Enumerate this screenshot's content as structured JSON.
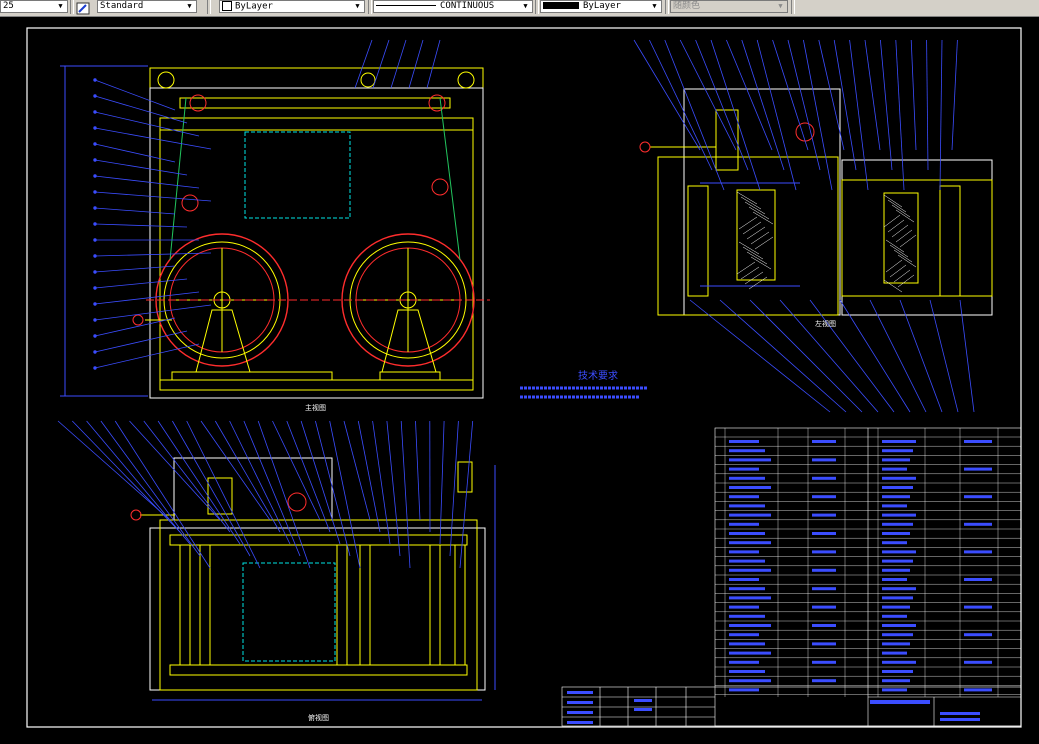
{
  "toolbar": {
    "dimstyle_value": "25",
    "textstyle_value": "Standard",
    "layer_value": "ByLayer",
    "linetype_value": "CONTINUOUS",
    "lineweight_value": "ByLayer",
    "plotstyle_value": "随颜色"
  },
  "drawing": {
    "notes_title": "技术要求",
    "view_label_front": "主视图",
    "view_label_top": "俯视图",
    "view_label_side": "左视图",
    "colors": {
      "frame": "#ffffff",
      "part": "#ffff00",
      "leader": "#3b4dff",
      "center": "#ff2d2d",
      "hidden": "#00e5e5",
      "green": "#22c55e"
    }
  }
}
